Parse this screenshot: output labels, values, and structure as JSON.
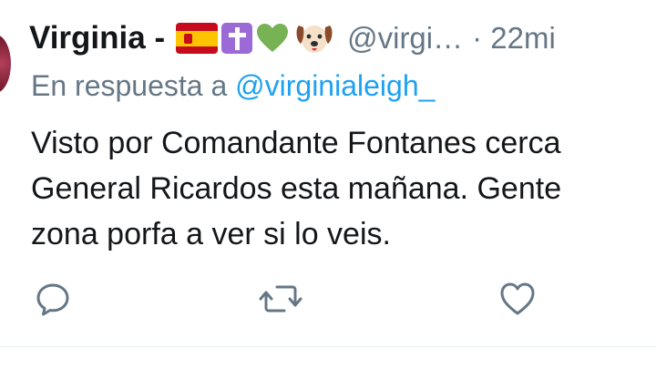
{
  "tweet": {
    "author_name": "Virginia -",
    "author_emojis": [
      "spain-flag",
      "latin-cross",
      "green-heart",
      "dog-face"
    ],
    "handle": "@virgi…",
    "time": "· 22mi",
    "reply_prefix": "En respuesta a",
    "reply_mention": "@virginialeigh_",
    "text_lines": [
      "Visto por Comandante Fontanes cerca",
      "General Ricardos esta mañana. Gente",
      "zona porfa a ver si lo veis."
    ]
  },
  "actions": {
    "icons": [
      "reply-icon",
      "retweet-icon",
      "like-icon"
    ]
  },
  "colors": {
    "text": "#14171a",
    "secondary": "#657786",
    "link": "#1da1f2",
    "heart": "#77b255",
    "divider": "#e6ecf0"
  }
}
